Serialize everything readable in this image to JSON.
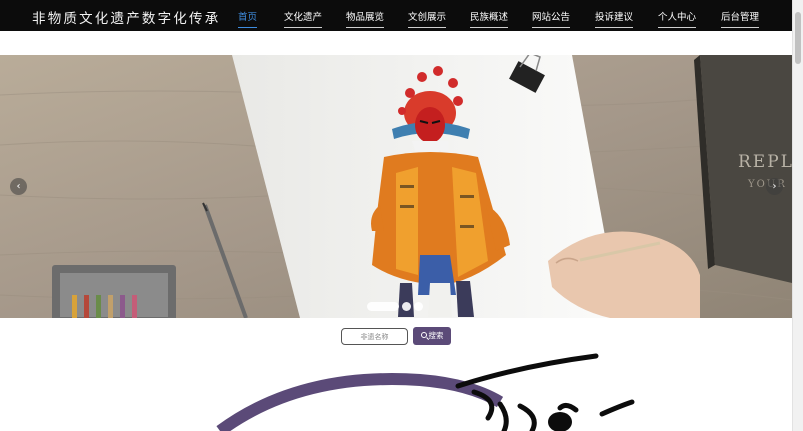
{
  "header": {
    "site_title": "非物质文化遗产数字化传承",
    "nav": [
      {
        "label": "首页",
        "active": true
      },
      {
        "label": "文化遗产",
        "active": false
      },
      {
        "label": "物品展览",
        "active": false
      },
      {
        "label": "文创展示",
        "active": false
      },
      {
        "label": "民族概述",
        "active": false
      },
      {
        "label": "网站公告",
        "active": false
      },
      {
        "label": "投诉建议",
        "active": false
      },
      {
        "label": "个人中心",
        "active": false
      },
      {
        "label": "后台管理",
        "active": false
      }
    ]
  },
  "banner": {
    "prev_icon": "chevron-left-icon",
    "next_icon": "chevron-right-icon",
    "prev_glyph": "‹",
    "next_glyph": "›",
    "book_text_1": "REPL",
    "book_text_2": "YOUR",
    "slide_count": 3,
    "active_slide": 1
  },
  "search": {
    "placeholder": "非遗名称",
    "button_label": "搜索",
    "button_icon": "search-icon"
  },
  "colors": {
    "topbar_bg": "#0c0c0c",
    "nav_active": "#3f8de0",
    "search_button": "#5b4a78",
    "decor_arc": "#5b4a78"
  }
}
